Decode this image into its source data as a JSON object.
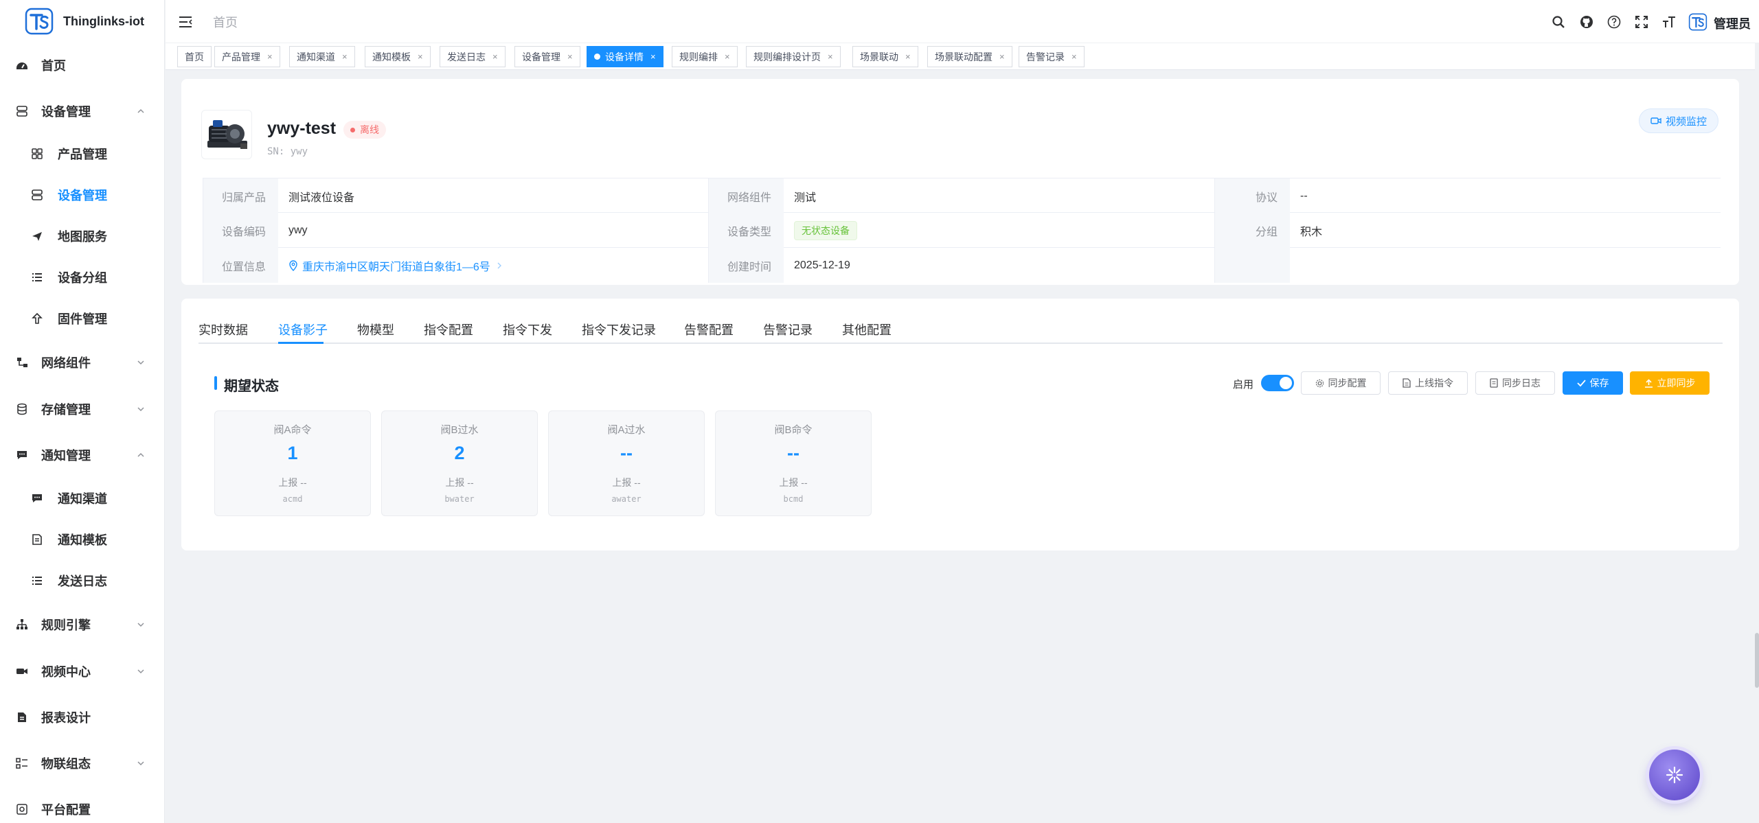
{
  "app": {
    "name": "Thinglinks-iot",
    "user": "管理员"
  },
  "sidebar": {
    "items": [
      {
        "label": "首页",
        "icon": "dashboard-icon"
      },
      {
        "label": "设备管理",
        "icon": "device-icon"
      },
      {
        "label": "产品管理",
        "icon": "grid-icon"
      },
      {
        "label": "设备管理",
        "icon": "device-icon",
        "active": true
      },
      {
        "label": "地图服务",
        "icon": "send-icon"
      },
      {
        "label": "设备分组",
        "icon": "list-icon"
      },
      {
        "label": "固件管理",
        "icon": "upload-icon"
      },
      {
        "label": "网络组件",
        "icon": "network-icon"
      },
      {
        "label": "存储管理",
        "icon": "database-icon"
      },
      {
        "label": "通知管理",
        "icon": "chat-icon"
      },
      {
        "label": "通知渠道",
        "icon": "chat-icon"
      },
      {
        "label": "通知模板",
        "icon": "template-icon"
      },
      {
        "label": "发送日志",
        "icon": "list-icon"
      },
      {
        "label": "规则引擎",
        "icon": "tree-icon"
      },
      {
        "label": "视频中心",
        "icon": "video-icon"
      },
      {
        "label": "报表设计",
        "icon": "report-icon"
      },
      {
        "label": "物联组态",
        "icon": "config-icon"
      },
      {
        "label": "平台配置",
        "icon": "settings-icon"
      }
    ]
  },
  "header": {
    "breadcrumb": "首页"
  },
  "tabs": [
    {
      "label": "首页"
    },
    {
      "label": "产品管理"
    },
    {
      "label": "通知渠道"
    },
    {
      "label": "通知模板"
    },
    {
      "label": "发送日志"
    },
    {
      "label": "设备管理"
    },
    {
      "label": "设备详情",
      "active": true
    },
    {
      "label": "规则编排"
    },
    {
      "label": "规则编排设计页"
    },
    {
      "label": "场景联动"
    },
    {
      "label": "场景联动配置"
    },
    {
      "label": "告警记录"
    }
  ],
  "device": {
    "name": "ywy-test",
    "status": "离线",
    "sn": "SN: ywy",
    "video_button": "视频监控",
    "info": {
      "product_label": "归属产品",
      "product": "测试液位设备",
      "network_label": "网络组件",
      "network": "测试",
      "protocol_label": "协议",
      "protocol": "--",
      "code_label": "设备编码",
      "code": "ywy",
      "type_label": "设备类型",
      "type": "无状态设备",
      "group_label": "分组",
      "group": "积木",
      "location_label": "位置信息",
      "location": "重庆市渝中区朝天门街道白象街1—6号",
      "created_label": "创建时间",
      "created": "2025-12-19"
    }
  },
  "detail_tabs": [
    {
      "label": "实时数据"
    },
    {
      "label": "设备影子",
      "active": true
    },
    {
      "label": "物模型"
    },
    {
      "label": "指令配置"
    },
    {
      "label": "指令下发"
    },
    {
      "label": "指令下发记录"
    },
    {
      "label": "告警配置"
    },
    {
      "label": "告警记录"
    },
    {
      "label": "其他配置"
    }
  ],
  "shadow": {
    "title": "期望状态",
    "enable_label": "启用",
    "enabled": true,
    "buttons": {
      "sync_config": "同步配置",
      "online_cmd": "上线指令",
      "sync_log": "同步日志",
      "save": "保存",
      "sync_now": "立即同步"
    },
    "properties": [
      {
        "name": "阀A命令",
        "value": "1",
        "report": "上报 --",
        "id": "acmd"
      },
      {
        "name": "阀B过水",
        "value": "2",
        "report": "上报 --",
        "id": "bwater"
      },
      {
        "name": "阀A过水",
        "value": "--",
        "report": "上报 --",
        "id": "awater"
      },
      {
        "name": "阀B命令",
        "value": "--",
        "report": "上报 --",
        "id": "bcmd"
      }
    ]
  },
  "colors": {
    "primary": "#1890ff",
    "warning": "#ffb300",
    "danger": "#f56c6c",
    "success": "#67c23a"
  }
}
